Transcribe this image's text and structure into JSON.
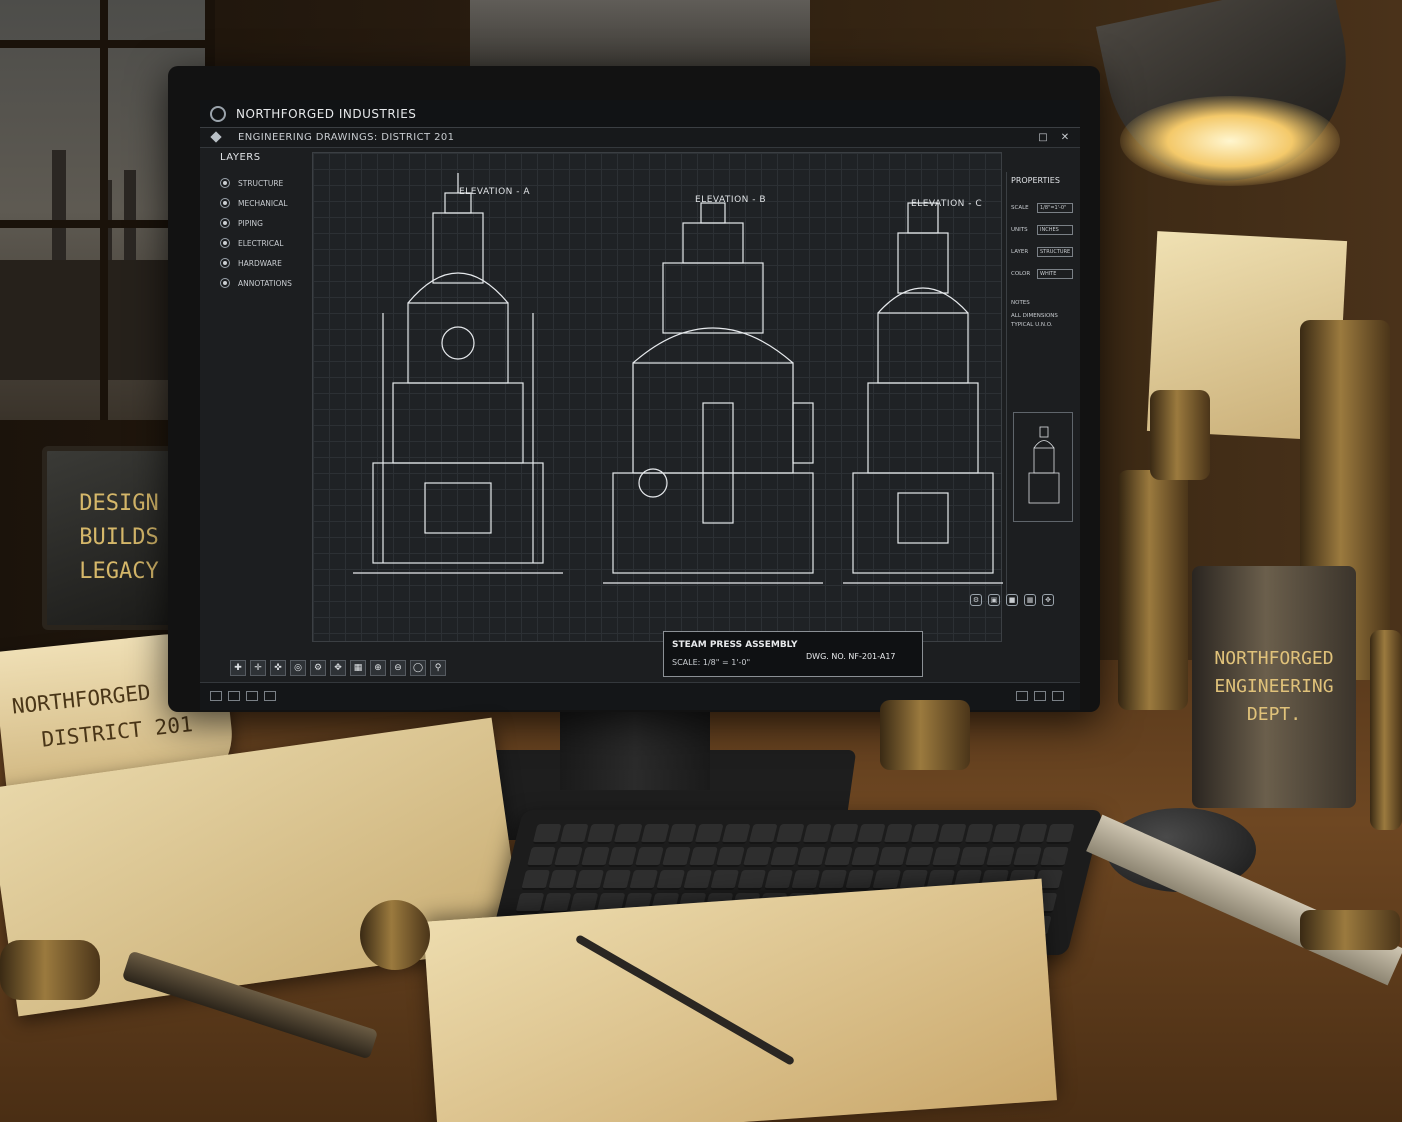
{
  "app": {
    "title": "NORTHFORGED INDUSTRIES",
    "subtitle": "ENGINEERING DRAWINGS: DISTRICT 201"
  },
  "layers": {
    "header": "LAYERS",
    "items": [
      {
        "label": "STRUCTURE"
      },
      {
        "label": "MECHANICAL"
      },
      {
        "label": "PIPING"
      },
      {
        "label": "ELECTRICAL"
      },
      {
        "label": "HARDWARE"
      },
      {
        "label": "ANNOTATIONS"
      }
    ]
  },
  "canvas": {
    "elevations": [
      "ELEVATION - A",
      "ELEVATION - B",
      "ELEVATION - C"
    ],
    "title_block": {
      "name": "STEAM PRESS ASSEMBLY",
      "scale": "SCALE: 1/8\" = 1'-0\"",
      "drawing_no": "DWG. NO. NF-201-A17"
    }
  },
  "properties": {
    "header": "PROPERTIES",
    "rows": [
      {
        "key": "SCALE",
        "value": "1/8\"=1'-0\""
      },
      {
        "key": "UNITS",
        "value": "INCHES"
      },
      {
        "key": "LAYER",
        "value": "STRUCTURE"
      },
      {
        "key": "COLOR",
        "value": "WHITE"
      }
    ],
    "notes_header": "NOTES",
    "notes_text": "ALL DIMENSIONS TYPICAL U.N.O."
  },
  "decor": {
    "plaque": [
      "DESIGN",
      "BUILDS",
      "LEGACY"
    ],
    "scroll": [
      "NORTHFORGED",
      "DISTRICT 201"
    ],
    "can": [
      "NORTHFORGED",
      "ENGINEERING",
      "DEPT."
    ]
  },
  "colors": {
    "screen_bg": "#1c1e20",
    "line": "#e6e9ec",
    "brass": "#9b7a3e",
    "lamp_glow": "#f4c96a"
  },
  "icons": [
    "settings-icon",
    "close-icon",
    "layer-eye-icon",
    "zoom-in-icon",
    "zoom-out-icon",
    "pan-icon",
    "grid-icon"
  ]
}
